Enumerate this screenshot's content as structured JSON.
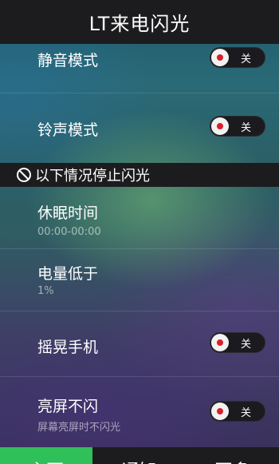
{
  "app": {
    "title": "LT来电闪光"
  },
  "toggles_top": [
    {
      "label": "静音模式",
      "state": "关"
    },
    {
      "label": "铃声模式",
      "state": "关"
    }
  ],
  "section": {
    "title": "以下情况停止闪光",
    "icon": "ban-icon"
  },
  "stop_items": {
    "sleep": {
      "label": "休眠时间",
      "value": "00:00-00:00"
    },
    "battery": {
      "label": "电量低于",
      "value": "1%"
    },
    "shake": {
      "label": "摇晃手机",
      "state": "关"
    },
    "screen_on": {
      "label": "亮屏不闪",
      "sub": "屏幕亮屏时不闪光",
      "state": "关"
    }
  },
  "tabs": [
    {
      "label": "主页",
      "active": true
    },
    {
      "label": "通知",
      "active": false
    },
    {
      "label": "更多",
      "active": false
    }
  ],
  "colors": {
    "accent": "#2fc05a",
    "bar": "#1c1c1e",
    "toggle_dot": "#d8202a"
  }
}
